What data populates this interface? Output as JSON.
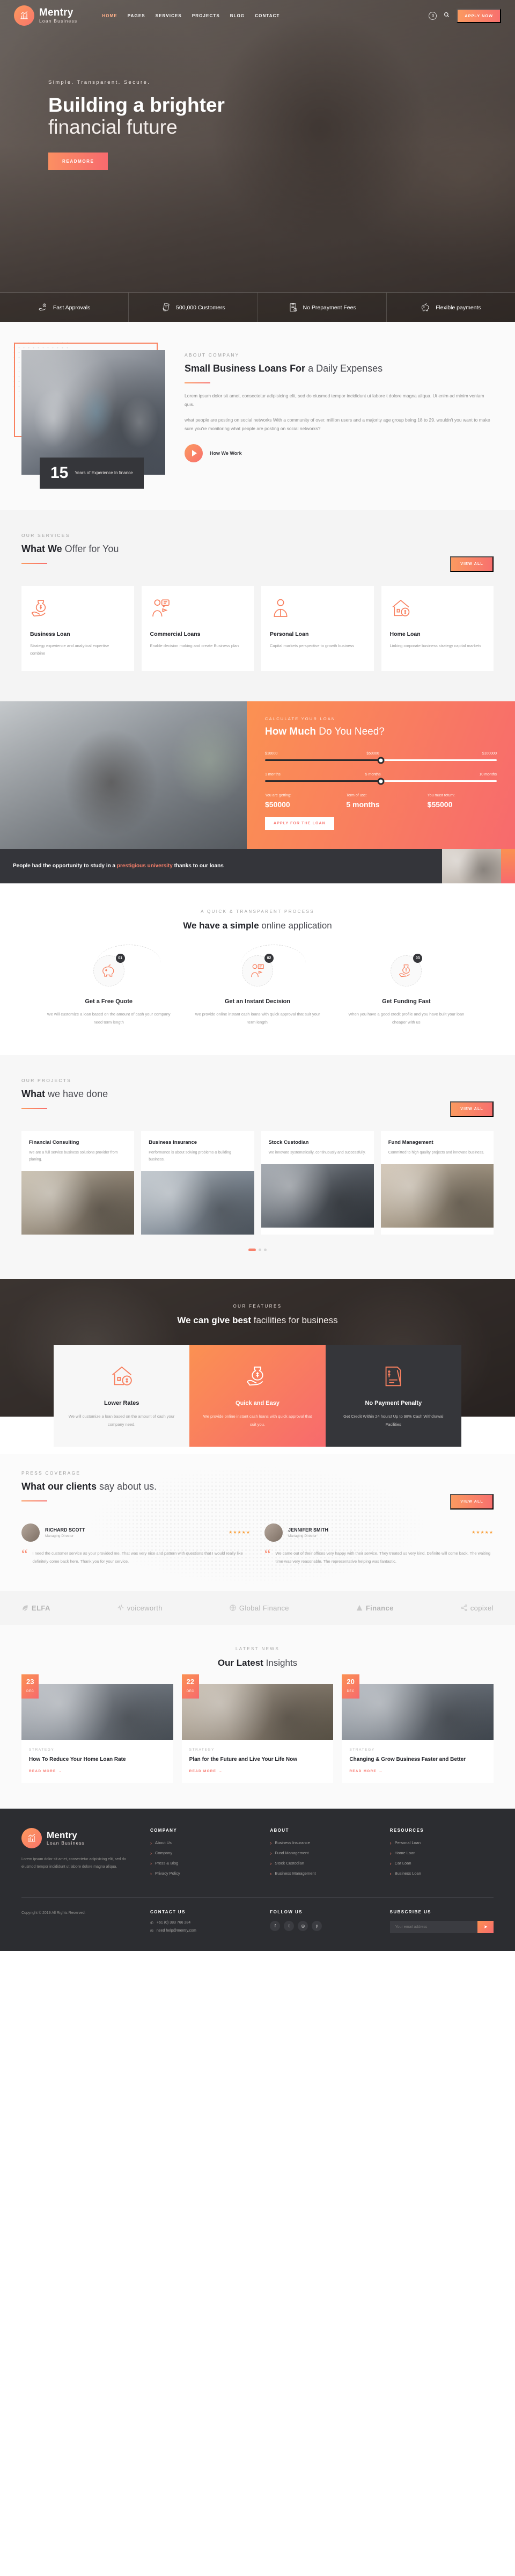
{
  "brand": {
    "name": "Mentry",
    "tagline": "Loan Business",
    "accent": "#f8806a",
    "accent2": "#fb9152"
  },
  "header": {
    "nav": [
      {
        "label": "HOME",
        "active": true
      },
      {
        "label": "PAGES",
        "active": false
      },
      {
        "label": "SERVICES",
        "active": false
      },
      {
        "label": "PROJECTS",
        "active": false
      },
      {
        "label": "BLOG",
        "active": false
      },
      {
        "label": "CONTACT",
        "active": false
      }
    ],
    "search_icon": "search-icon",
    "cart_icon": "cart-icon",
    "apply_label": "APPLY NOW"
  },
  "hero": {
    "eyebrow": "Simple. Transparent. Secure.",
    "title_bold": "Building a brighter",
    "title_thin": "financial future",
    "cta": "READMORE",
    "features": [
      {
        "icon": "hand-dollar-icon",
        "label": "Fast Approvals"
      },
      {
        "icon": "card-hand-icon",
        "label": "500,000 Customers"
      },
      {
        "icon": "checklist-icon",
        "label": "No Prepayment Fees"
      },
      {
        "icon": "piggy-bank-icon",
        "label": "Flexible payments"
      }
    ]
  },
  "about": {
    "kicker": "ABOUT COMPANY",
    "title_bold": "Small Business Loans For",
    "title_thin": " a Daily Expenses",
    "paragraph1": "Lorem ipsum dolor sit amet, consectetur adipisicing elit, sed do eiusmod tempor incididunt ut labore t dolore magna aliqua. Ut enim ad minim veniam quis.",
    "paragraph2": "what people are posting on social networks With a community of over. million users and a majority age group being 18 to 29. wouldn't you want to make sure you're monitoring what people are posting on social networks?",
    "video_label": "How We Work",
    "badge_number": "15",
    "badge_label": "Years of Experience In finance"
  },
  "services": {
    "kicker": "OUR SERVICES",
    "title_bold": "What We",
    "title_thin": " Offer for You",
    "view_all": "VIEW ALL",
    "cards": [
      {
        "icon": "hand-money-icon",
        "title": "Business Loan",
        "desc": "Strategy experience and analytical expertise combine"
      },
      {
        "icon": "advisor-icon",
        "title": "Commercial Loans",
        "desc": "Enable decision making and create Business plan"
      },
      {
        "icon": "person-icon",
        "title": "Personal Loan",
        "desc": "Capital markets perspective to growth business"
      },
      {
        "icon": "home-dollar-icon",
        "title": "Home Loan",
        "desc": "Linking corporate business strategy capital markets"
      }
    ]
  },
  "calculator": {
    "kicker": "CALCULATE YOUR LOAN",
    "title_bold": "How Much",
    "title_thin": " Do You Need?",
    "amount": {
      "min": "$10000",
      "current": "$50000",
      "max": "$100000",
      "percent": 50
    },
    "term": {
      "min": "1 months",
      "current": "5 months",
      "max": "10 months",
      "percent": 50
    },
    "results": [
      {
        "label": "You are getting:",
        "value": "$50000"
      },
      {
        "label": "Term of use:",
        "value": "5 months"
      },
      {
        "label": "You must return:",
        "value": "$55000"
      }
    ],
    "cta": "APPLY FOR THE LOAN"
  },
  "quote_strip": {
    "text_1": "People had the opportunity to study in a ",
    "highlight_1": "prestigious university",
    "text_2": " thanks to our loans"
  },
  "process": {
    "kicker": "A QUICK & TRANSPARENT PROCESS",
    "title_bold": "We have a simple",
    "title_thin": " online application",
    "steps": [
      {
        "num": "01",
        "icon": "piggy-bank-icon",
        "title": "Get a Free Quote",
        "desc": "We will customize a loan based on the amount of cash your company need term length"
      },
      {
        "num": "02",
        "icon": "advisor-icon",
        "title": "Get an Instant Decision",
        "desc": "We provide online instant cash loans with quick approval that suit your term length"
      },
      {
        "num": "03",
        "icon": "hand-money-icon",
        "title": "Get Funding Fast",
        "desc": "When you have a good credit profile and you have built your loan cheaper with us"
      }
    ]
  },
  "projects": {
    "kicker": "OUR PROJECTS",
    "title_bold": "What",
    "title_thin": " we have done",
    "view_all": "VIEW ALL",
    "cards": [
      {
        "title": "Financial Consulting",
        "desc": "We are a full service business solutions provider from planing."
      },
      {
        "title": "Business Insurance",
        "desc": "Performance is about solving problems & building business."
      },
      {
        "title": "Stock Custodian",
        "desc": "We innovate systematically, continuously and successfully."
      },
      {
        "title": "Fund Management",
        "desc": "Committed to high quality projects and innovate business."
      }
    ]
  },
  "features": {
    "kicker": "OUR FEATURES",
    "title_bold": "We can give best",
    "title_thin": " facilities for business",
    "cards": [
      {
        "icon": "home-dollar-icon",
        "title": "Lower Rates",
        "desc": "We will customize a loan based on the amount of cash your company need."
      },
      {
        "icon": "hand-money-icon",
        "title": "Quick and Easy",
        "desc": "We provide online instant cash loans with quick approval that suit you."
      },
      {
        "icon": "invoice-icon",
        "title": "No Payment Penalty",
        "desc": "Get Credit Within 24 hours! Up to 98% Cash Withdrawal Facilities"
      }
    ]
  },
  "testimonials": {
    "kicker": "PRESS COVERAGE",
    "title_bold": "What our clients",
    "title_thin": " say about us.",
    "view_all": "VIEW ALL",
    "items": [
      {
        "name": "RICHARD SCOTT",
        "role": "Managing Director",
        "stars": "★★★★★",
        "quote": "I need the customer service as your provided me. That was very nice and pattern with questions that I would really like definitely come back here. Thank you for your service."
      },
      {
        "name": "JENNIFER SMITH",
        "role": "Managing Director",
        "stars": "★★★★★",
        "quote": "We came out of their offices very happy with their service. They treated us very kind. Definite will come back. The waiting time was very reasonable. The representative helping was fantastic."
      }
    ]
  },
  "clients": [
    {
      "name": "ELFA",
      "icon": "leaf-icon"
    },
    {
      "name": "voiceworth",
      "icon": "wave-icon"
    },
    {
      "name": "Global Finance",
      "icon": "globe-icon"
    },
    {
      "name": "Finance",
      "icon": "triangle-icon"
    },
    {
      "name": "copixel",
      "icon": "share-icon"
    }
  ],
  "blog": {
    "kicker": "LATEST NEWS",
    "title_bold": "Our Latest",
    "title_thin": " Insights",
    "posts": [
      {
        "day": "23",
        "month": "DEC",
        "category": "STRATEGY",
        "title": "How To Reduce Your Home Loan Rate",
        "more": "READ MORE"
      },
      {
        "day": "22",
        "month": "DEC",
        "category": "STRATEGY",
        "title": "Plan for the Future and Live Your Life Now",
        "more": "READ MORE"
      },
      {
        "day": "20",
        "month": "DEC",
        "category": "STRATEGY",
        "title": "Changing & Grow Business Faster and Better",
        "more": "READ MORE"
      }
    ]
  },
  "footer": {
    "about_text": "Lorem ipsum dolor sit amet, consectetur adipisicing elit, sed do eiusmod tempor incididunt ut labore dolore magna aliqua.",
    "columns": [
      {
        "title": "COMPANY",
        "items": [
          "About Us",
          "Company",
          "Press & Blog",
          "Privacy Policy"
        ]
      },
      {
        "title": "ABOUT",
        "items": [
          "Business Insurance",
          "Fund Management",
          "Stock Custodian",
          "Business Management"
        ]
      },
      {
        "title": "RESOURCES",
        "items": [
          "Personal Loan",
          "Home Loan",
          "Car Loan",
          "Business Loan"
        ]
      }
    ],
    "copyright": "Copyright © 2019 All Rights Reserved.",
    "contact_title": "CONTACT US",
    "contact_phone": "+61 (0) 383 766 284",
    "contact_email": "need help@mentry.com",
    "follow_title": "FOLLOW US",
    "socials": [
      "facebook-icon",
      "twitter-icon",
      "instagram-icon",
      "pinterest-icon"
    ],
    "subscribe_title": "SUBSCRIBE US",
    "subscribe_placeholder": "Your email address",
    "subscribe_button": "send-icon"
  }
}
